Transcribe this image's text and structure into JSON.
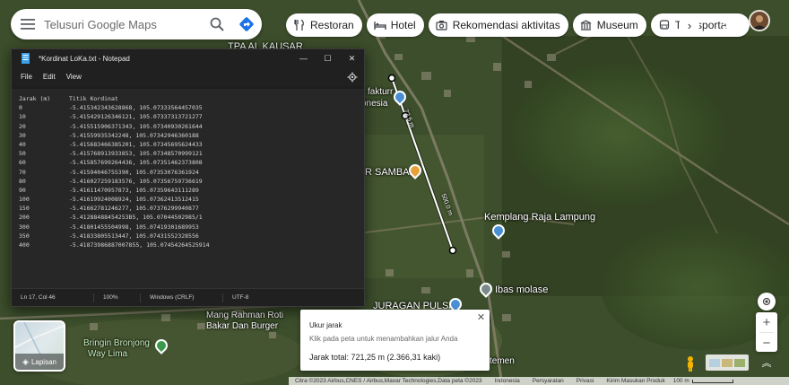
{
  "search": {
    "placeholder": "Telusuri Google Maps"
  },
  "chips": [
    {
      "label": "Restoran",
      "icon": "fork-knife-icon"
    },
    {
      "label": "Hotel",
      "icon": "bed-icon"
    },
    {
      "label": "Rekomendasi aktivitas",
      "icon": "camera-icon"
    },
    {
      "label": "Museum",
      "icon": "museum-icon"
    },
    {
      "label": "Transporta",
      "icon": "bus-icon"
    }
  ],
  "map_labels": {
    "tpa": "TPA AL KAUSAR",
    "manufaktur_line1": "fakturr",
    "manufaktur_line2": "onesia",
    "sambal": "R SAMBAL",
    "kemplang": "Kemplang Raja Lampung",
    "ibas": "Ibas molase",
    "juragan": "JURAGAN PULSA",
    "mang_line1": "Mang Rahman Roti",
    "mang_line2": "Bakar Dan Burger",
    "bringin_line1": "Bringin Bronjong",
    "bringin_line2": "Way Lima",
    "temen": "temen",
    "route_seg1": "72,5 m",
    "route_seg2": "500,0 m",
    "top_fragment": "SL"
  },
  "notepad": {
    "title": "*Kordinat LoKa.txt - Notepad",
    "menus": [
      "File",
      "Edit",
      "View"
    ],
    "header": {
      "col1": "Jarak (m)",
      "col2": "Titik Kordinat"
    },
    "rows": [
      {
        "d": "0",
        "c": "-5.415342343628868, 105.07333564457035"
      },
      {
        "d": "10",
        "c": "-5.415429126346121, 105.07337313721277"
      },
      {
        "d": "20",
        "c": "-5.415515906371343, 105.07340930261644"
      },
      {
        "d": "30",
        "c": "-5.41559935342248, 105.07342946360188"
      },
      {
        "d": "40",
        "c": "-5.415683466385201, 105.07345695624433"
      },
      {
        "d": "50",
        "c": "-5.415768913933853, 105.07348570999121"
      },
      {
        "d": "60",
        "c": "-5.415857699264436, 105.07351462373808"
      },
      {
        "d": "70",
        "c": "-5.41594046755390, 105.07353076361924"
      },
      {
        "d": "80",
        "c": "-5.416027259183576, 105.07356759736619"
      },
      {
        "d": "90",
        "c": "-5.41611470957873, 105.07359643111289"
      },
      {
        "d": "100",
        "c": "-5.41619924008924, 105.07362413512415"
      },
      {
        "d": "150",
        "c": "-5.41662781246277, 105.07376299940877"
      },
      {
        "d": "200",
        "c": "-5.41288488454253B5, 105.07044502985/1"
      },
      {
        "d": "300",
        "c": "-5.41801455504998, 105.07419301689953"
      },
      {
        "d": "350",
        "c": "-5.41833805513447, 105.07431552328556"
      },
      {
        "d": "400",
        "c": "-5.41873986887007855, 105.07454264525914"
      }
    ],
    "status": {
      "position": "Ln 17, Col 46",
      "zoom": "100%",
      "eol": "Windows (CRLF)",
      "encoding": "UTF-8"
    }
  },
  "layers": {
    "label": "Lapisan"
  },
  "measure": {
    "title": "Ukur jarak",
    "hint": "Klik pada peta untuk menambahkan jalur Anda",
    "total": "Jarak total: 721,25 m (2.366,31 kaki)"
  },
  "bottom_bar": {
    "credits": "Citra ©2023 Airbus,CNES / Airbus,Maxar Technologies,Data peta ©2023",
    "links": [
      "Indonesia",
      "Persyaratan",
      "Privasi",
      "Kirim Masukan Produk"
    ],
    "scale": "100 m"
  },
  "colors": {
    "directions": "#1a73e8",
    "pin_blue": "#4a8fd4",
    "pin_orange": "#e8a13a",
    "notepad_bg": "#272727"
  }
}
